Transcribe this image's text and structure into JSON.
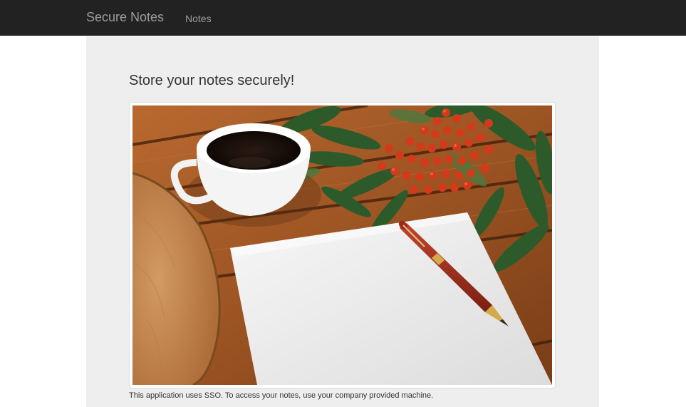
{
  "navbar": {
    "brand": "Secure Notes",
    "links": [
      {
        "label": "Notes"
      }
    ]
  },
  "main": {
    "heading": "Store your notes securely!",
    "image_description_visible": false,
    "footnote": "This application uses SSO. To access your notes, use your company provided machine."
  },
  "colors": {
    "navbar_bg": "#222222",
    "navbar_text": "#9d9d9d",
    "jumbotron_bg": "#eeeeee",
    "text": "#333333"
  }
}
